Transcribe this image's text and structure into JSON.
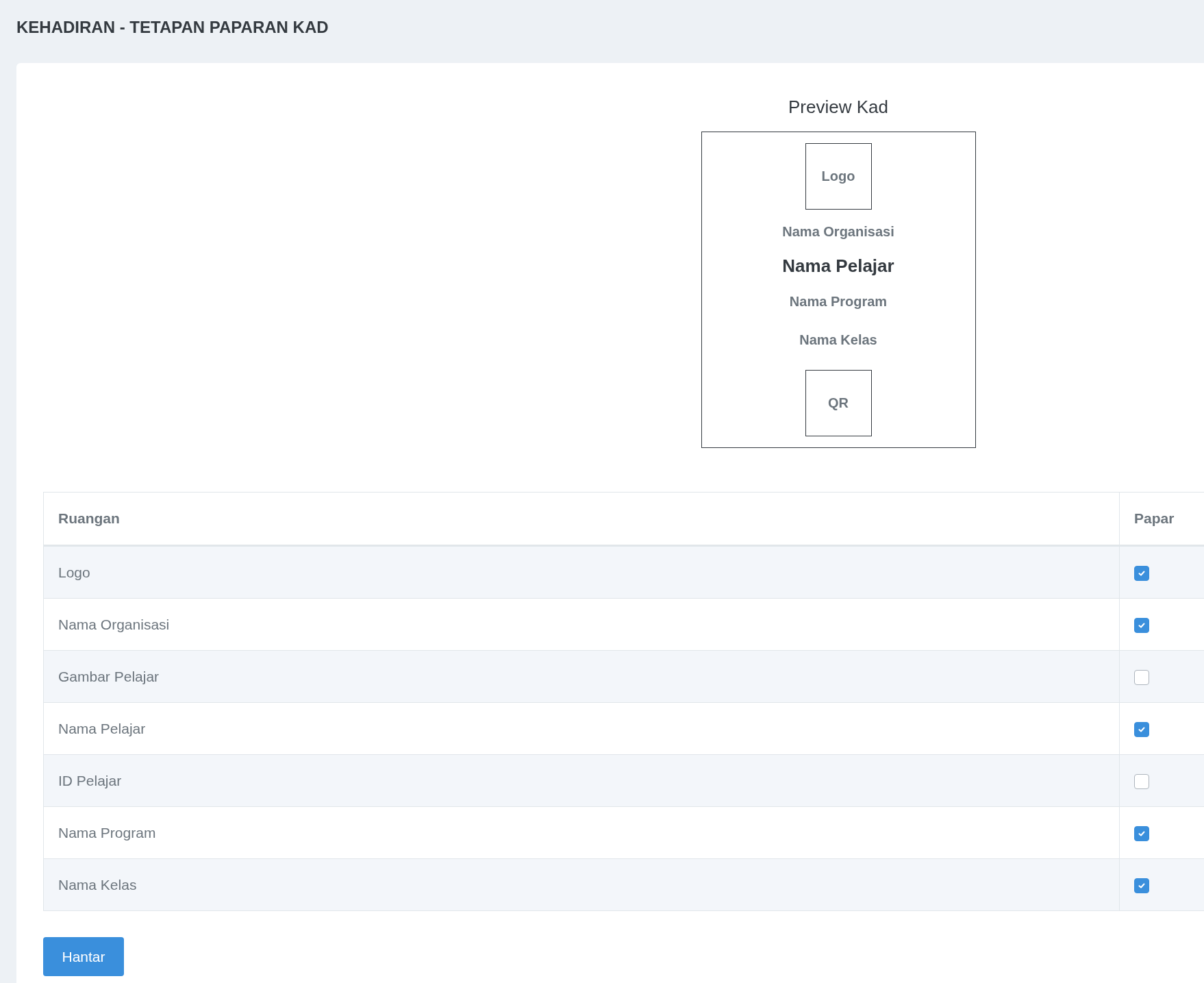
{
  "page_title": "KEHADIRAN - TETAPAN PAPARAN KAD",
  "preview": {
    "title": "Preview Kad",
    "items": [
      {
        "kind": "box",
        "label": "Logo"
      },
      {
        "kind": "text",
        "label": "Nama Organisasi"
      },
      {
        "kind": "heading",
        "label": "Nama Pelajar"
      },
      {
        "kind": "text",
        "label": "Nama Program"
      },
      {
        "kind": "text",
        "label": "Nama Kelas"
      },
      {
        "kind": "box",
        "label": "QR"
      }
    ]
  },
  "table": {
    "columns": [
      "Ruangan",
      "Papar"
    ],
    "rows": [
      {
        "field": "Logo",
        "checked": true
      },
      {
        "field": "Nama Organisasi",
        "checked": true
      },
      {
        "field": "Gambar Pelajar",
        "checked": false
      },
      {
        "field": "Nama Pelajar",
        "checked": true
      },
      {
        "field": "ID Pelajar",
        "checked": false
      },
      {
        "field": "Nama Program",
        "checked": true
      },
      {
        "field": "Nama Kelas",
        "checked": true
      }
    ]
  },
  "submit_button": "Hantar"
}
